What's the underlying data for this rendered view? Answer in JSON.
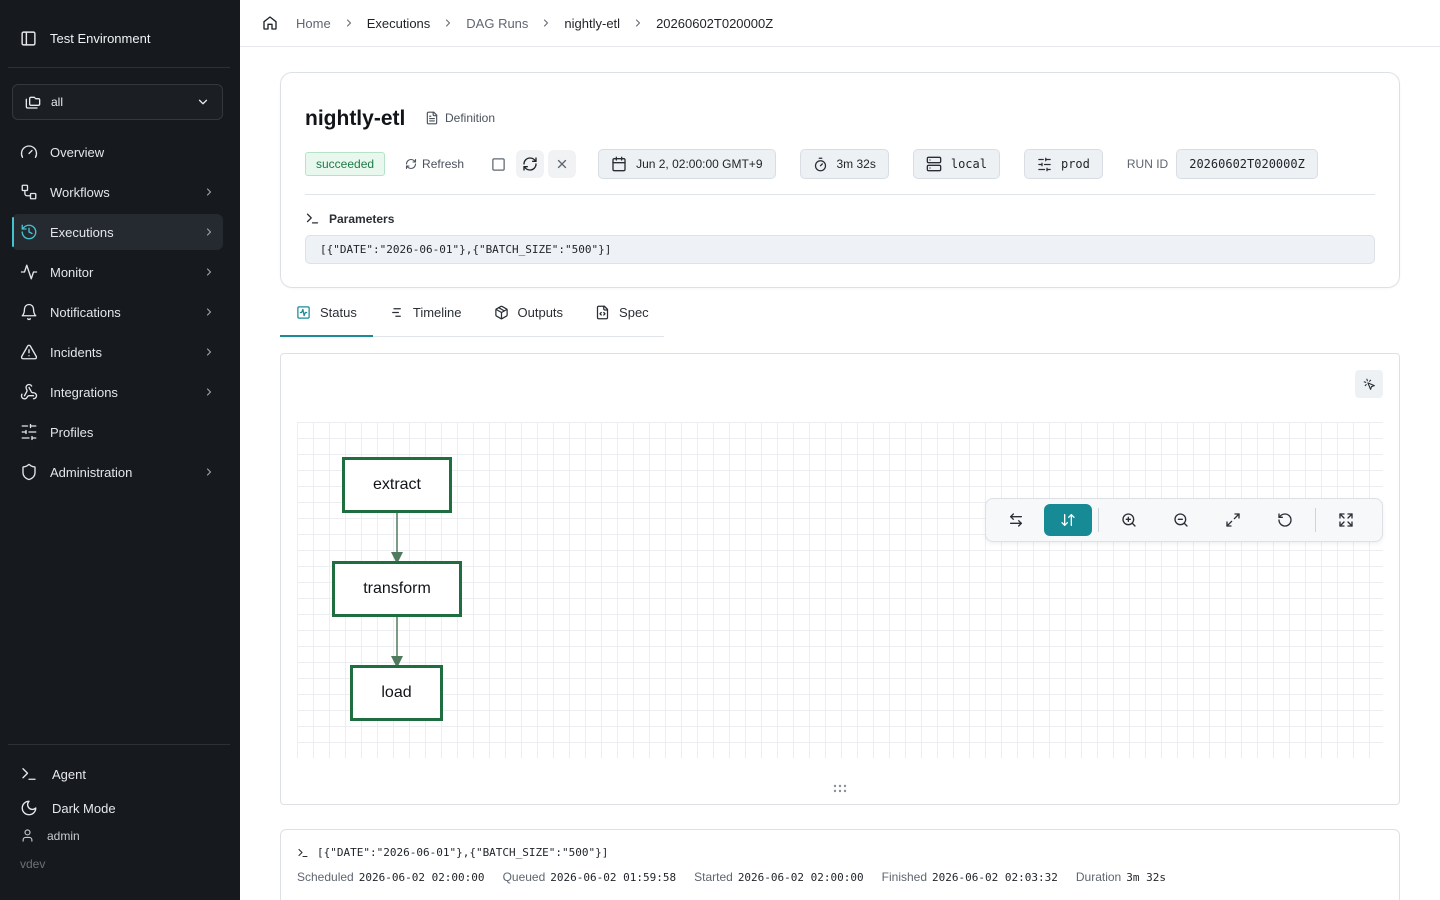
{
  "sidebar": {
    "environment": "Test Environment",
    "selector_value": "all",
    "nav": [
      {
        "label": "Overview",
        "icon": "gauge-icon"
      },
      {
        "label": "Workflows",
        "icon": "workflow-icon"
      },
      {
        "label": "Executions",
        "icon": "history-icon"
      },
      {
        "label": "Monitor",
        "icon": "activity-icon"
      },
      {
        "label": "Notifications",
        "icon": "bell-icon"
      },
      {
        "label": "Incidents",
        "icon": "alert-triangle-icon"
      },
      {
        "label": "Integrations",
        "icon": "webhook-icon"
      },
      {
        "label": "Profiles",
        "icon": "sliders-icon"
      },
      {
        "label": "Administration",
        "icon": "shield-icon"
      }
    ],
    "agent_label": "Agent",
    "dark_mode_label": "Dark Mode",
    "user": "admin",
    "version": "vdev"
  },
  "breadcrumb": [
    "Home",
    "Executions",
    "DAG Runs",
    "nightly-etl",
    "20260602T020000Z"
  ],
  "run": {
    "name": "nightly-etl",
    "definition_label": "Definition",
    "status": "succeeded",
    "refresh_label": "Refresh",
    "scheduled_chip": "Jun 2, 02:00:00 GMT+9",
    "duration_chip": "3m 32s",
    "executor": "local",
    "profile": "prod",
    "run_id_label": "RUN ID",
    "run_id": "20260602T020000Z"
  },
  "parameters": {
    "label": "Parameters",
    "value": "[{\"DATE\":\"2026-06-01\"},{\"BATCH_SIZE\":\"500\"}]"
  },
  "tabs": [
    {
      "label": "Status",
      "icon": "activity-square-icon"
    },
    {
      "label": "Timeline",
      "icon": "gantt-icon"
    },
    {
      "label": "Outputs",
      "icon": "package-icon"
    },
    {
      "label": "Spec",
      "icon": "file-code-icon"
    }
  ],
  "graph": {
    "nodes": [
      "extract",
      "transform",
      "load"
    ]
  },
  "details": {
    "params": "[{\"DATE\":\"2026-06-01\"},{\"BATCH_SIZE\":\"500\"}]",
    "scheduled_label": "Scheduled",
    "scheduled": "2026-06-02 02:00:00",
    "queued_label": "Queued",
    "queued": "2026-06-02 01:59:58",
    "started_label": "Started",
    "started": "2026-06-02 02:00:00",
    "finished_label": "Finished",
    "finished": "2026-06-02 02:03:32",
    "duration_label": "Duration",
    "duration": "3m 32s"
  },
  "colors": {
    "sidebar_bg": "#16191d",
    "accent": "#168a95",
    "node_border": "#1f6e3f",
    "success": "#1e7a46"
  }
}
